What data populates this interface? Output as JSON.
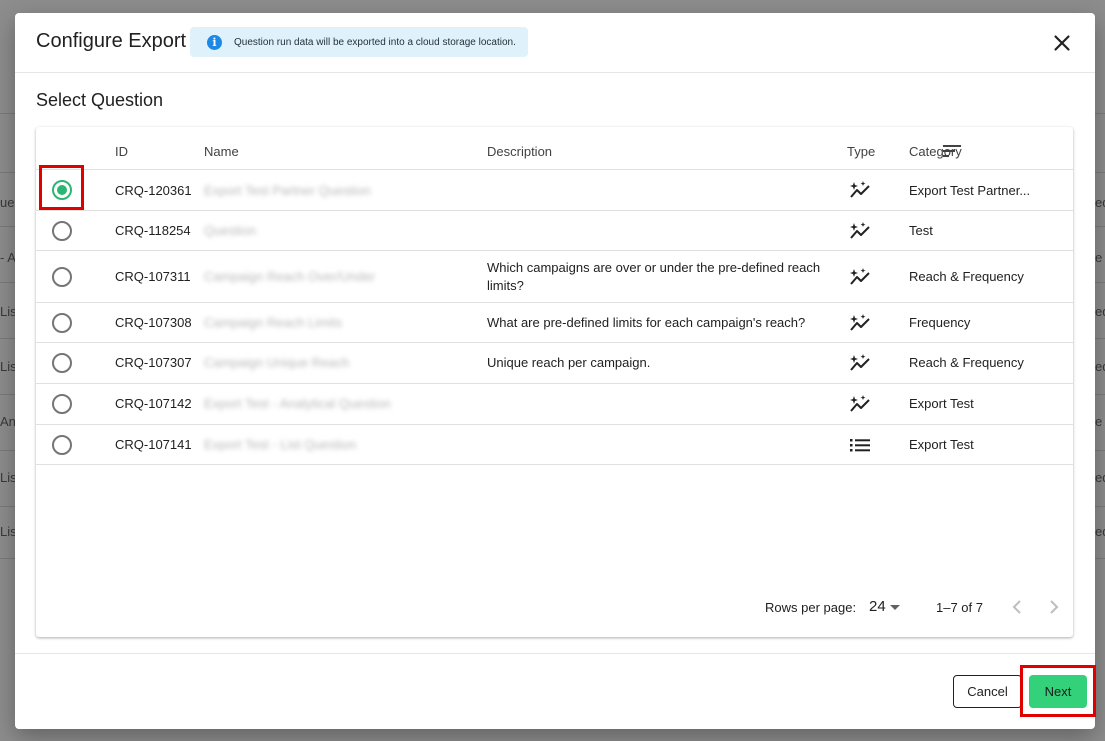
{
  "background": {
    "left_fragments": [
      "ue",
      "- A",
      "List",
      "List",
      "An",
      "Lis",
      "Lis"
    ],
    "right_fragments": [
      "ed",
      "e",
      "ed",
      "ed",
      "e",
      "ed",
      "ed"
    ]
  },
  "modal": {
    "title": "Configure Export",
    "info_banner": "Question run data will be exported into a cloud storage location.",
    "section_title": "Select Question",
    "columns": {
      "id": "ID",
      "name": "Name",
      "description": "Description",
      "type": "Type",
      "category": "Category"
    },
    "rows": [
      {
        "selected": true,
        "id": "CRQ-120361",
        "name": "Export Test Partner Question",
        "description": "",
        "type_icon": "analytical-sparkle-icon",
        "category": "Export Test Partner..."
      },
      {
        "selected": false,
        "id": "CRQ-118254",
        "name": "Question",
        "description": "",
        "type_icon": "analytical-sparkle-icon",
        "category": "Test"
      },
      {
        "selected": false,
        "id": "CRQ-107311",
        "name": "Campaign Reach Over/Under",
        "description": "Which campaigns are over or under the pre-defined reach limits?",
        "type_icon": "analytical-sparkle-icon",
        "category": "Reach & Frequency"
      },
      {
        "selected": false,
        "id": "CRQ-107308",
        "name": "Campaign Reach Limits",
        "description": "What are pre-defined limits for each campaign's reach?",
        "type_icon": "analytical-sparkle-icon",
        "category": "Frequency"
      },
      {
        "selected": false,
        "id": "CRQ-107307",
        "name": "Campaign Unique Reach",
        "description": "Unique reach per campaign.",
        "type_icon": "analytical-sparkle-icon",
        "category": "Reach & Frequency"
      },
      {
        "selected": false,
        "id": "CRQ-107142",
        "name": "Export Test - Analytical Question",
        "description": "",
        "type_icon": "analytical-sparkle-icon",
        "category": "Export Test"
      },
      {
        "selected": false,
        "id": "CRQ-107141",
        "name": "Export Test - List Question",
        "description": "",
        "type_icon": "list-icon",
        "category": "Export Test"
      }
    ],
    "pagination": {
      "rows_per_page_label": "Rows per page:",
      "rows_per_page_value": "24",
      "range": "1–7 of 7"
    },
    "buttons": {
      "cancel": "Cancel",
      "next": "Next"
    },
    "colors": {
      "accent_green": "#33d17a",
      "radio_green": "#2bb673",
      "info_bg": "#dff2fc",
      "info_icon": "#1e88e5",
      "highlight_red": "#e00000"
    }
  }
}
